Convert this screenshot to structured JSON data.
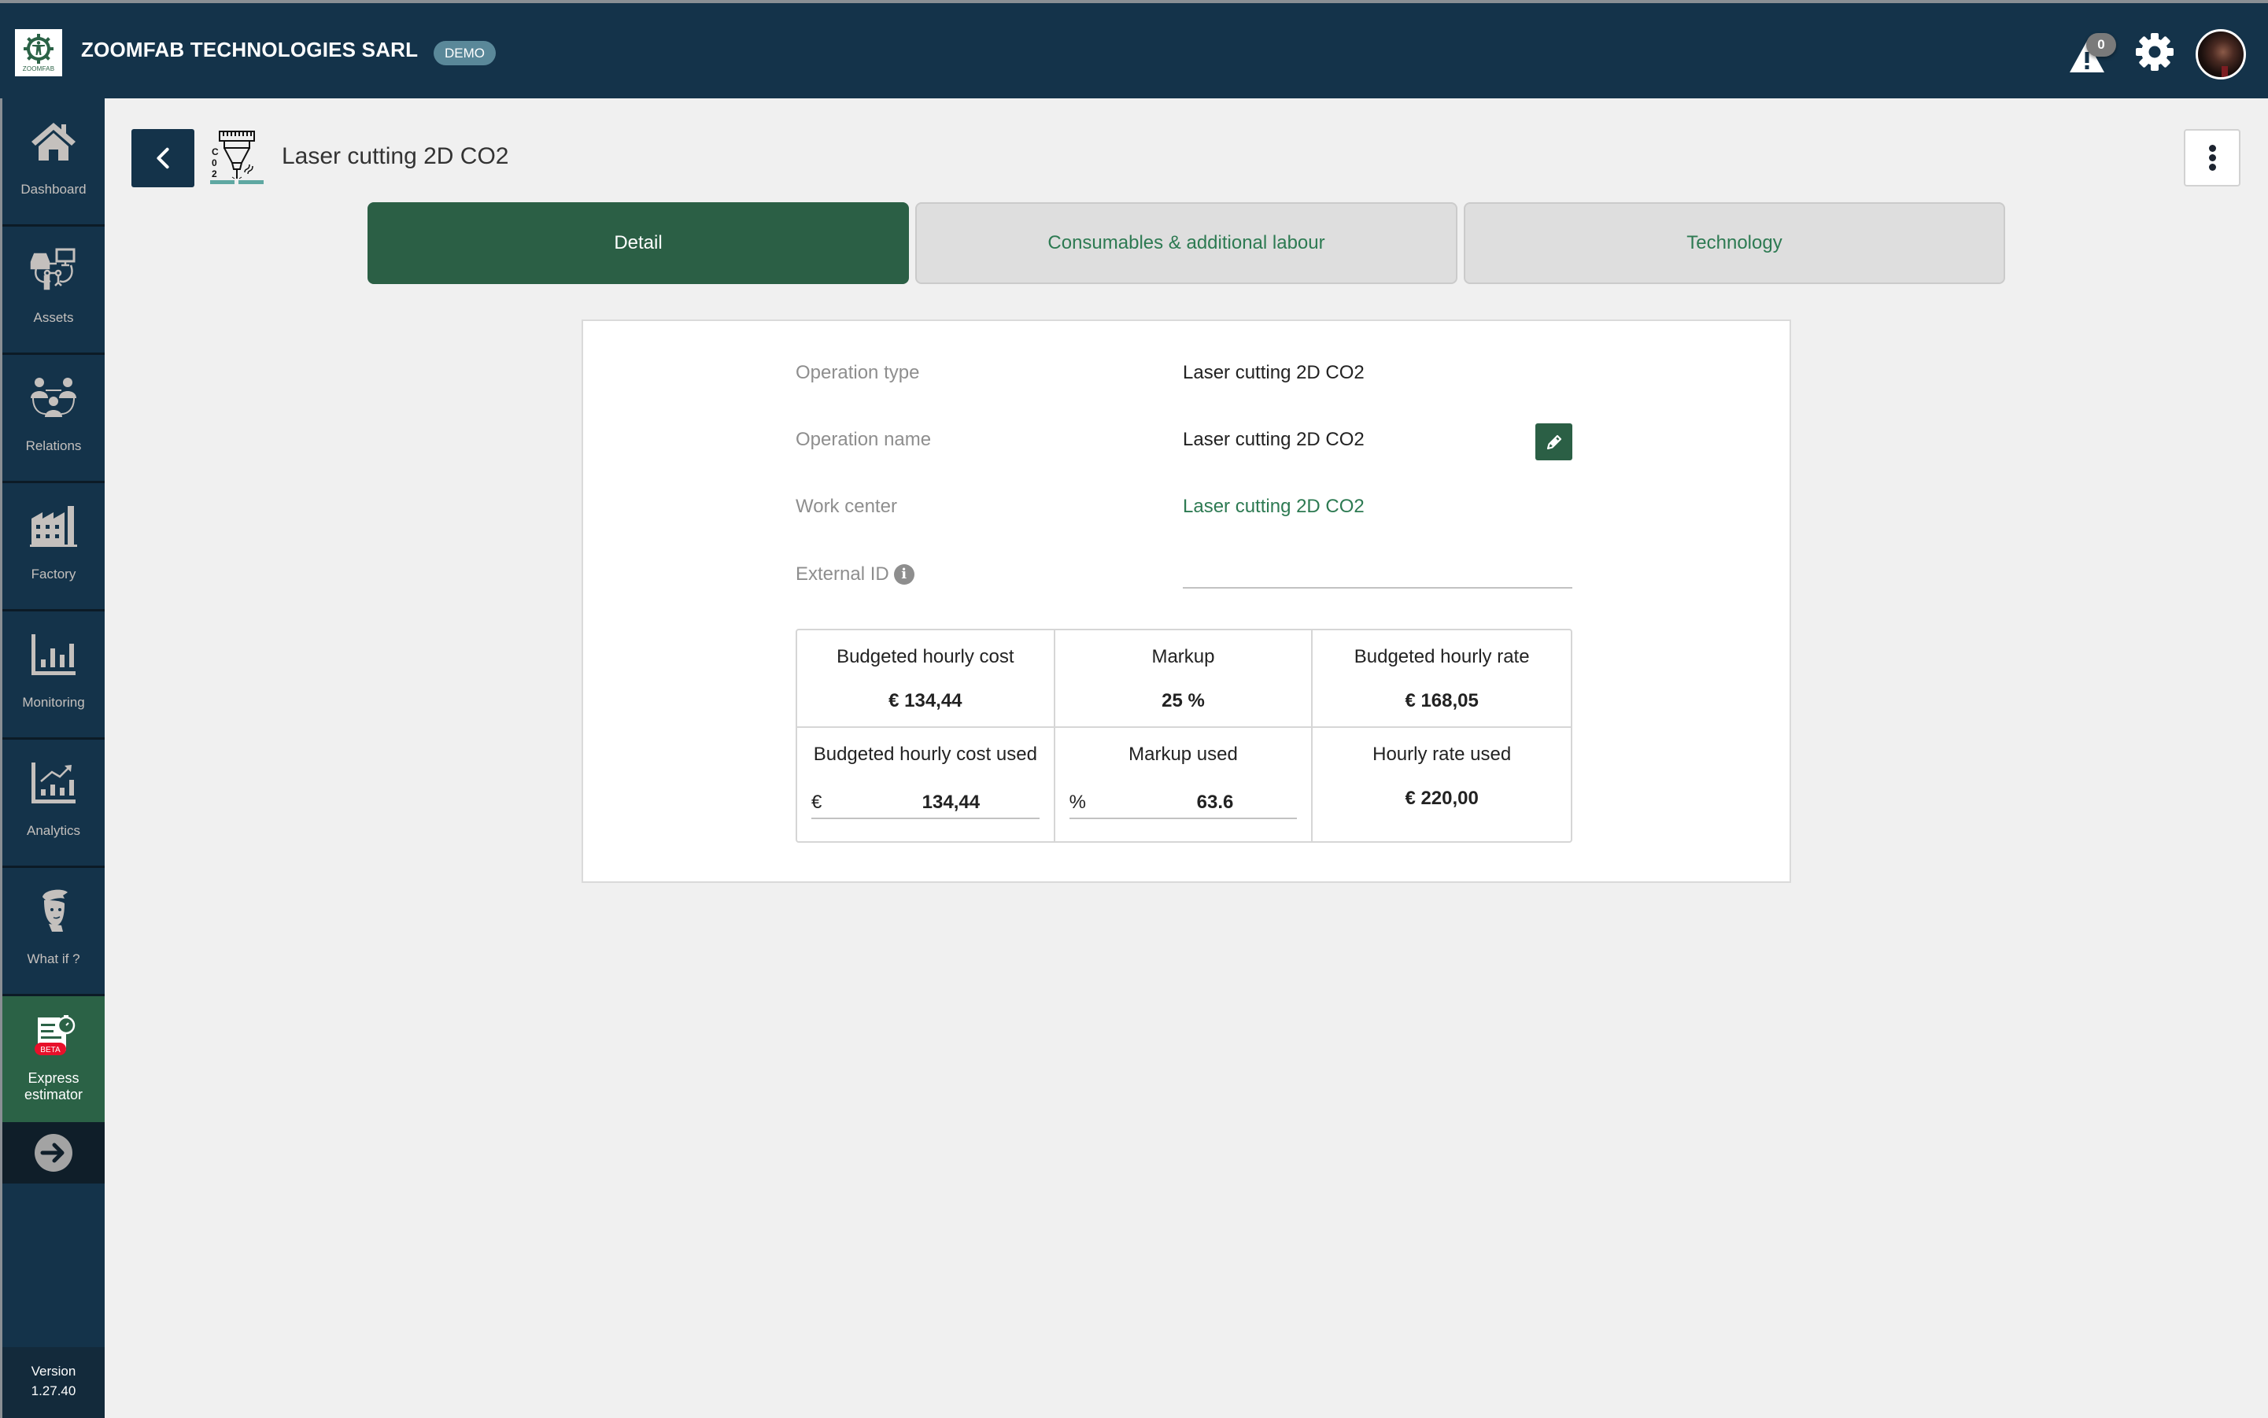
{
  "topbar": {
    "logo_text": "ZOOMFAB",
    "company_name": "ZOOMFAB TECHNOLOGIES SARL",
    "env_badge": "DEMO",
    "alert_count": "0",
    "icons": {
      "alerts": "alert-triangle-icon",
      "settings": "gear-icon",
      "profile": "avatar"
    }
  },
  "sidebar": {
    "items": [
      {
        "label": "Dashboard",
        "icon": "home-icon"
      },
      {
        "label": "Assets",
        "icon": "assets-icon"
      },
      {
        "label": "Relations",
        "icon": "relations-icon"
      },
      {
        "label": "Factory",
        "icon": "factory-icon"
      },
      {
        "label": "Monitoring",
        "icon": "bar-chart-icon"
      },
      {
        "label": "Analytics",
        "icon": "trend-chart-icon"
      },
      {
        "label": "What if ?",
        "icon": "thinking-person-icon"
      },
      {
        "label_line1": "Express",
        "label_line2": "estimator",
        "badge": "BETA",
        "icon": "express-estimator-icon",
        "active": true
      }
    ],
    "collapse_icon": "arrow-right-circle-icon",
    "version_label": "Version",
    "version_number": "1.27.40"
  },
  "page": {
    "title": "Laser cutting 2D CO2",
    "icon": "laser-co2-icon",
    "icon_text": [
      "C",
      "0",
      "2"
    ]
  },
  "tabs": [
    {
      "label": "Detail",
      "active": true
    },
    {
      "label": "Consumables & additional labour",
      "active": false
    },
    {
      "label": "Technology",
      "active": false
    }
  ],
  "detail": {
    "fields": [
      {
        "label": "Operation type",
        "value": "Laser cutting 2D CO2"
      },
      {
        "label": "Operation name",
        "value": "Laser cutting 2D CO2",
        "editable": true
      },
      {
        "label": "Work center",
        "value": "Laser cutting 2D CO2",
        "link": true
      },
      {
        "label": "External ID",
        "value": "",
        "info": true
      }
    ],
    "costs": {
      "budgeted_hourly_cost": {
        "label": "Budgeted hourly cost",
        "value": "€ 134,44"
      },
      "markup": {
        "label": "Markup",
        "value": "25 %"
      },
      "budgeted_hourly_rate": {
        "label": "Budgeted hourly rate",
        "value": "€ 168,05"
      },
      "budgeted_hourly_cost_used": {
        "label": "Budgeted hourly cost used",
        "prefix": "€",
        "value": "134,44"
      },
      "markup_used": {
        "label": "Markup used",
        "prefix": "%",
        "value": "63.6"
      },
      "hourly_rate_used": {
        "label": "Hourly rate used",
        "value": "€ 220,00"
      }
    }
  },
  "colors": {
    "topbar_bg": "#14334a",
    "accent_green": "#2b5f45",
    "link_green": "#2d7a52",
    "beta_red": "#e8102a",
    "demo_badge": "#5a8899"
  }
}
